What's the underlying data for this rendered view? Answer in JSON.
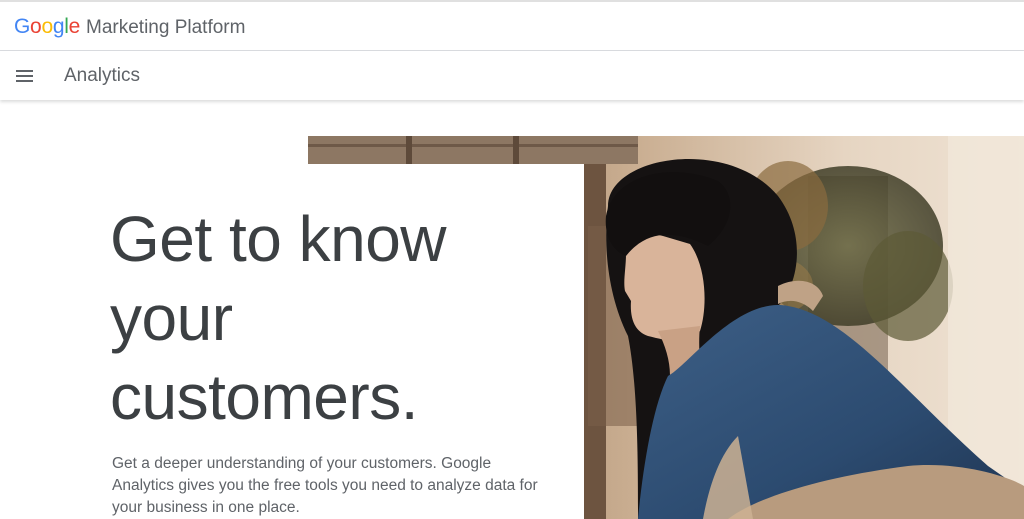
{
  "brand": {
    "logo_letters": [
      "G",
      "o",
      "o",
      "g",
      "l",
      "e"
    ],
    "logo_colors": [
      "#4285F4",
      "#EA4335",
      "#FBBC05",
      "#4285F4",
      "#34A853",
      "#EA4335"
    ],
    "platform_name": "Marketing Platform"
  },
  "product_bar": {
    "menu_icon": "hamburger-menu-icon",
    "title": "Analytics"
  },
  "hero": {
    "heading_lines": [
      "Get to know",
      "your",
      "customers."
    ],
    "body": "Get a deeper understanding of your customers. Google Analytics gives you the free tools you need to analyze data for your business in one place."
  },
  "colors": {
    "heading_text": "#3c4043",
    "body_text": "#5f6368",
    "divider": "#dadce0"
  }
}
